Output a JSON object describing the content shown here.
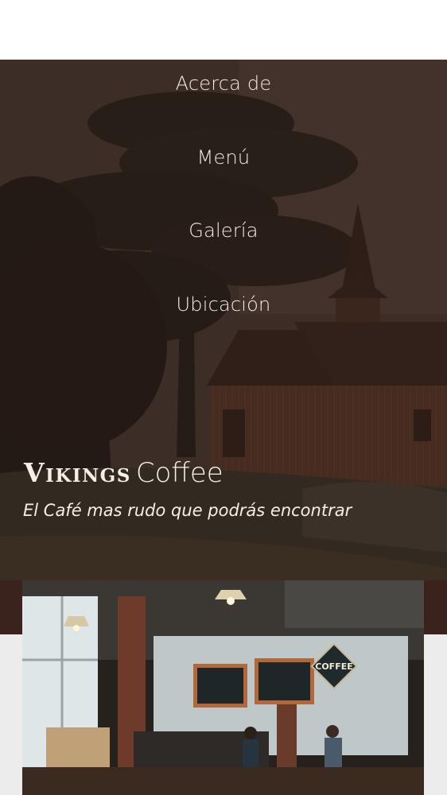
{
  "nav": {
    "items": [
      "Acerca de",
      "Menú",
      "Galería",
      "Ubicación"
    ]
  },
  "brand": {
    "name_strong": "Vikings",
    "name_light": "Coffee",
    "tagline": "El Café mas rudo que podrás encontrar"
  },
  "photo": {
    "sign_text": "COFFEE"
  },
  "colors": {
    "band_dark": "#3a231c",
    "band_light": "#ececec",
    "text_light": "#f3ece8"
  }
}
